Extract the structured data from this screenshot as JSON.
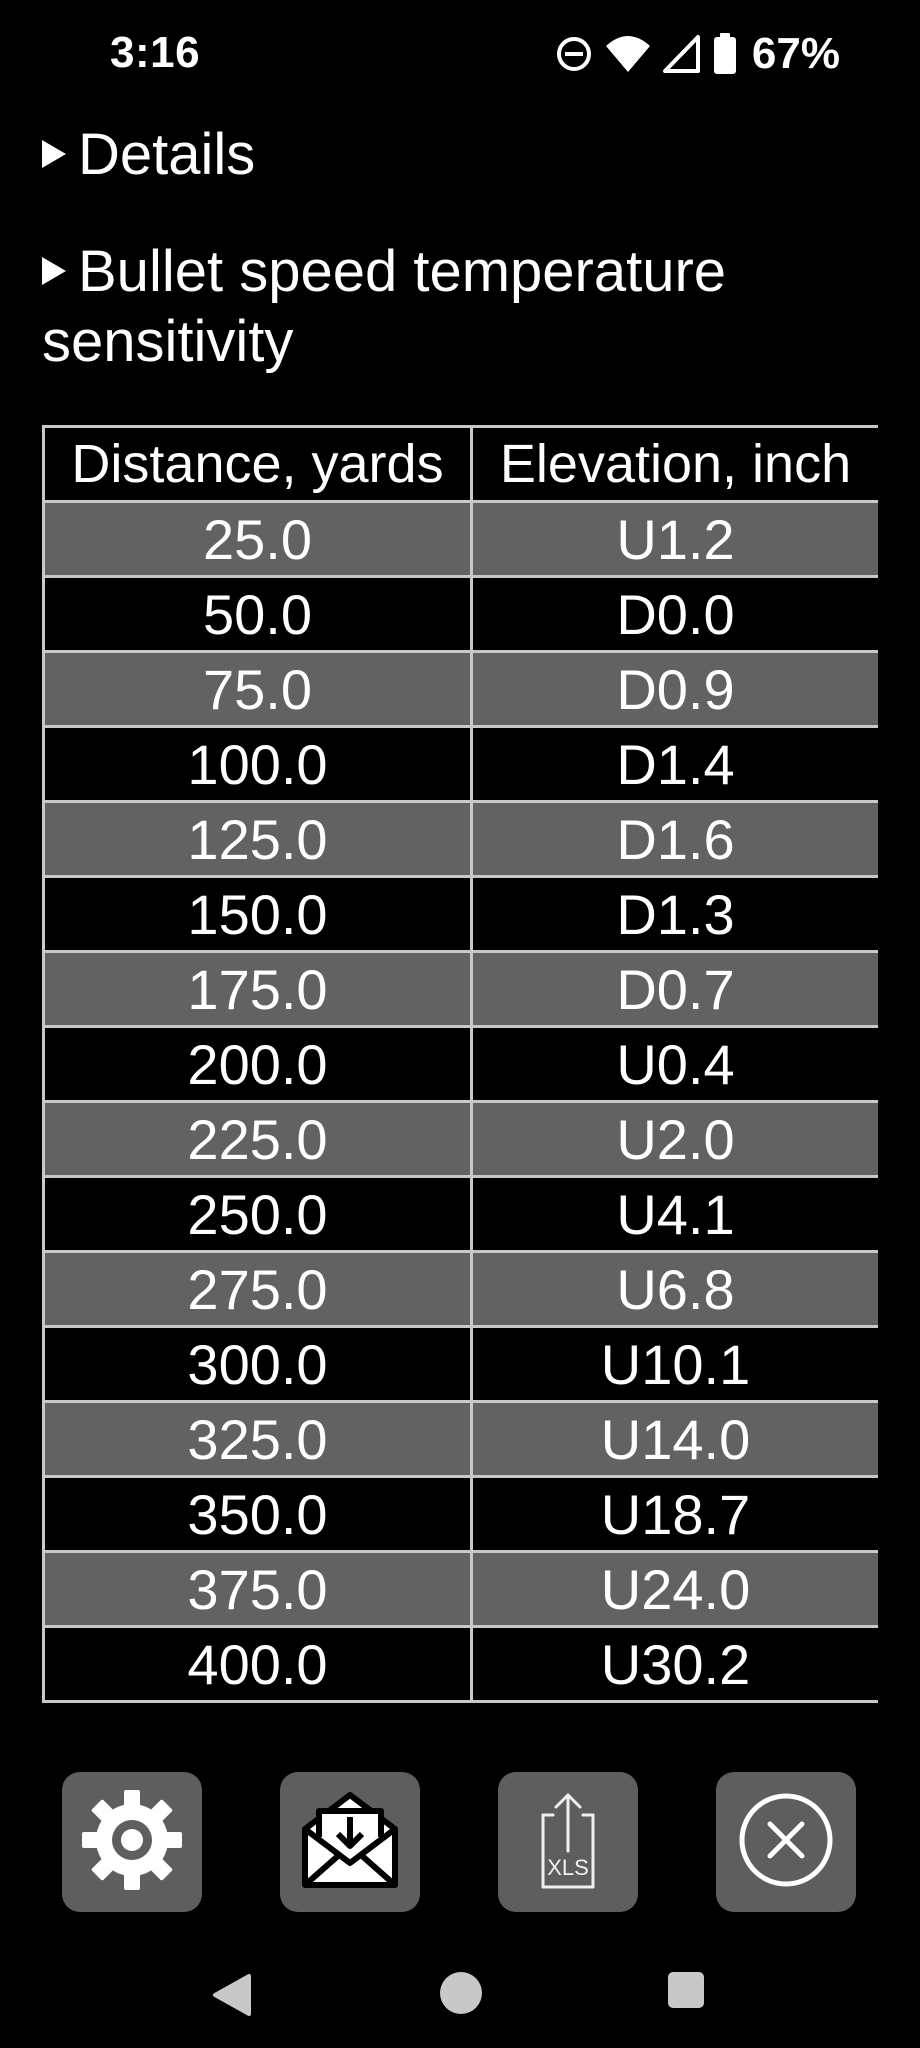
{
  "status_bar": {
    "time": "3:16",
    "battery_percent": "67%",
    "icons": [
      "do-not-disturb-icon",
      "wifi-icon",
      "cell-signal-icon",
      "battery-icon"
    ]
  },
  "sections": {
    "details_label": "Details",
    "bullet_label": "Bullet speed temperature sensitivity"
  },
  "table": {
    "headers": [
      "Distance, yards",
      "Elevation, inch"
    ],
    "rows": [
      [
        "25.0",
        "U1.2"
      ],
      [
        "50.0",
        "D0.0"
      ],
      [
        "75.0",
        "D0.9"
      ],
      [
        "100.0",
        "D1.4"
      ],
      [
        "125.0",
        "D1.6"
      ],
      [
        "150.0",
        "D1.3"
      ],
      [
        "175.0",
        "D0.7"
      ],
      [
        "200.0",
        "U0.4"
      ],
      [
        "225.0",
        "U2.0"
      ],
      [
        "250.0",
        "U4.1"
      ],
      [
        "275.0",
        "U6.8"
      ],
      [
        "300.0",
        "U10.1"
      ],
      [
        "325.0",
        "U14.0"
      ],
      [
        "350.0",
        "U18.7"
      ],
      [
        "375.0",
        "U24.0"
      ],
      [
        "400.0",
        "U30.2"
      ]
    ]
  },
  "toolbar": {
    "export_badge": "XLS",
    "icons": [
      "gear-icon",
      "mail-download-icon",
      "xls-export-icon",
      "close-circle-icon"
    ]
  },
  "colors": {
    "background": "#000000",
    "row_alt": "#626262",
    "grid": "#c8c8c8",
    "button": "#5e5e5e"
  }
}
